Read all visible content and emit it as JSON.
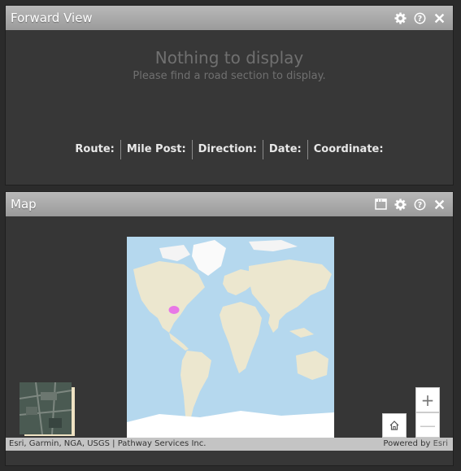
{
  "forward_view": {
    "title": "Forward View",
    "empty_title": "Nothing to display",
    "empty_subtitle": "Please find a road section to display.",
    "info_fields": [
      "Route:",
      "Mile Post:",
      "Direction:",
      "Date:",
      "Coordinate:"
    ],
    "icons": [
      "gear-icon",
      "help-icon",
      "close-icon"
    ]
  },
  "map": {
    "title": "Map",
    "icons": [
      "window-icon",
      "gear-icon",
      "help-icon",
      "close-icon"
    ],
    "zoom_in_label": "+",
    "zoom_out_label": "—",
    "attribution": "Esri, Garmin, NGA, USGS | Pathway Services Inc.",
    "powered_by": "Powered by",
    "powered_by_brand": "Esri",
    "colors": {
      "marker": "#e86be8",
      "water": "#b5d8ee",
      "land": "#ece7cf",
      "ice": "#ffffff"
    }
  }
}
